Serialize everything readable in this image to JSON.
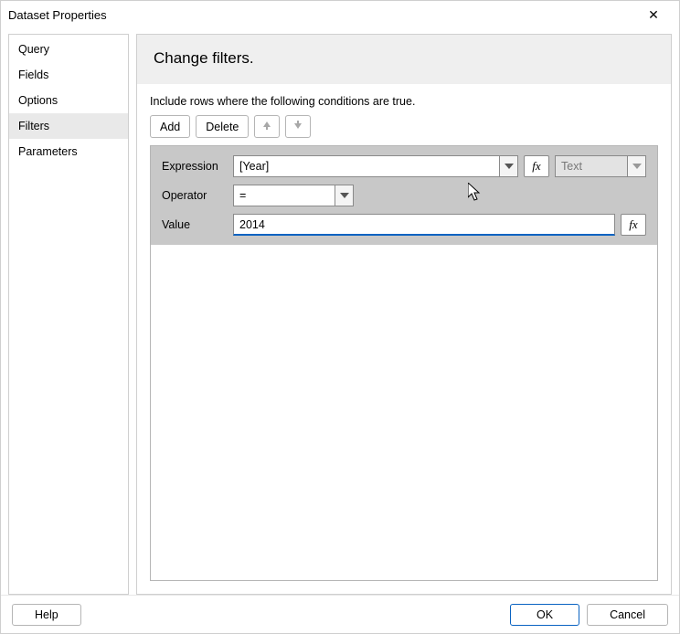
{
  "window": {
    "title": "Dataset Properties",
    "close_icon": "✕"
  },
  "sidebar": {
    "items": [
      {
        "label": "Query"
      },
      {
        "label": "Fields"
      },
      {
        "label": "Options"
      },
      {
        "label": "Filters",
        "selected": true
      },
      {
        "label": "Parameters"
      }
    ]
  },
  "main": {
    "header": "Change filters.",
    "instruction": "Include rows where the following conditions are true.",
    "toolbar": {
      "add": "Add",
      "delete": "Delete"
    },
    "filter": {
      "expression_label": "Expression",
      "expression_value": "[Year]",
      "type_value": "Text",
      "operator_label": "Operator",
      "operator_value": "=",
      "value_label": "Value",
      "value_value": "2014",
      "fx": "fx"
    }
  },
  "footer": {
    "help": "Help",
    "ok": "OK",
    "cancel": "Cancel"
  }
}
